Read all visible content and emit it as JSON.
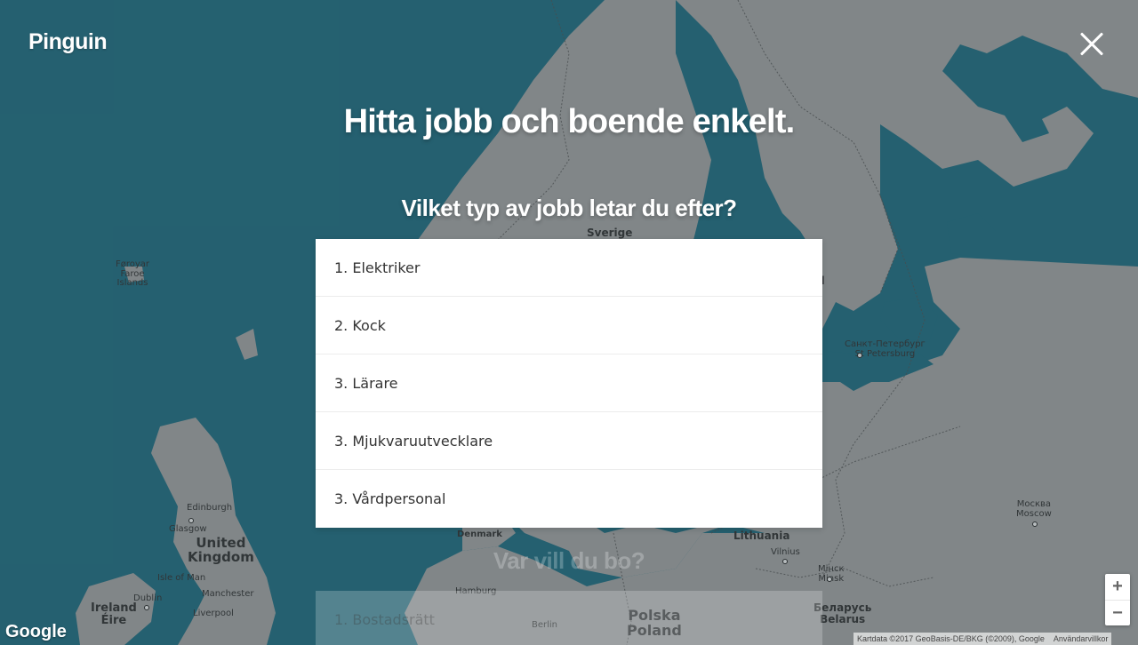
{
  "app": {
    "logo": "Pinguin"
  },
  "hero": {
    "headline": "Hitta jobb och boende enkelt.",
    "question": "Vilket typ av jobb letar du efter?"
  },
  "jobs": [
    "1. Elektriker",
    "2. Kock",
    "3. Lärare",
    "3. Mjukvaruutvecklare",
    "3. Vårdpersonal"
  ],
  "next_step": {
    "question": "Var vill du bo?",
    "first_option": "1. Bostadsrätt"
  },
  "map": {
    "labels": {
      "sverige": "Sverige",
      "faroe": "Føroyar\nFaroe\nIslands",
      "spb": "Санкт-Петербург\nSt Petersburg",
      "edinburgh": "Edinburgh",
      "glasgow": "Glasgow",
      "uk": "United\nKingdom",
      "isle_of_man": "Isle of Man",
      "manchester": "Manchester",
      "liverpool": "Liverpool",
      "dublin": "Dublin",
      "ireland": "Ireland\nÉire",
      "denmark": "Denmark",
      "hamburg": "Hamburg",
      "berlin": "Berlin",
      "polska": "Polska\nPoland",
      "lithuania": "Lithuania",
      "vilnius": "Vilnius",
      "minsk": "Мінск\nMinsk",
      "belarus": "Беларусь\nBelarus",
      "moscow": "Москва\nMoscow",
      "fin_partial": "i\nd"
    },
    "google": "Google",
    "attribution": "Kartdata ©2017 GeoBasis-DE/BKG (©2009), Google",
    "terms": "Användarvillkor",
    "zoom_in": "+",
    "zoom_out": "−",
    "colors": {
      "water": "#2b6d7e",
      "land": "#9a9a9a"
    }
  },
  "icons": {
    "close": "close-icon"
  }
}
